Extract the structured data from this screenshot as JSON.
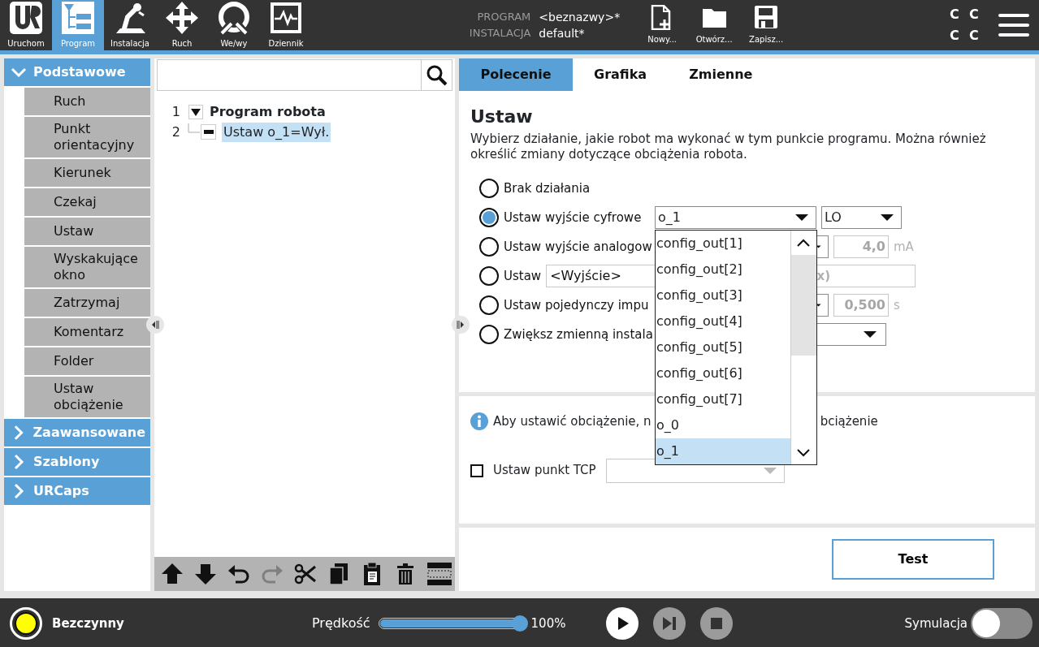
{
  "top_nav": [
    {
      "kind": "run",
      "label": "Uruchom",
      "selected": false
    },
    {
      "kind": "program",
      "label": "Program",
      "selected": true
    },
    {
      "kind": "installation",
      "label": "Instalacja",
      "selected": false
    },
    {
      "kind": "move",
      "label": "Ruch",
      "selected": false
    },
    {
      "kind": "io",
      "label": "We/wy",
      "selected": false
    },
    {
      "kind": "log",
      "label": "Dziennik",
      "selected": false
    }
  ],
  "file_info": [
    {
      "label": "PROGRAM",
      "value": "<beznazwy>*"
    },
    {
      "label": "INSTALACJA",
      "value": "default*"
    }
  ],
  "file_buttons": [
    {
      "kind": "new",
      "label": "Nowy..."
    },
    {
      "kind": "open",
      "label": "Otwórz..."
    },
    {
      "kind": "save",
      "label": "Zapisz..."
    }
  ],
  "indicators": [
    "C",
    "C",
    "C",
    "C"
  ],
  "sidebar": {
    "sections": [
      {
        "label": "Podstawowe",
        "expanded": true,
        "items": [
          "Ruch",
          "Punkt orientacyjny",
          "Kierunek",
          "Czekaj",
          "Ustaw",
          "Wyskakujące okno",
          "Zatrzymaj",
          "Komentarz",
          "Folder",
          "Ustaw obciążenie"
        ]
      },
      {
        "label": "Zaawansowane",
        "expanded": false
      },
      {
        "label": "Szablony",
        "expanded": false
      },
      {
        "label": "URCaps",
        "expanded": false
      }
    ]
  },
  "tree": {
    "nodes": [
      {
        "line": "1",
        "label": "Program robota",
        "expanded": true,
        "selected": false,
        "children": [
          {
            "line": "2",
            "label": "Ustaw o_1=Wył.",
            "selected": true
          }
        ]
      }
    ],
    "tools": [
      {
        "kind": "move-up",
        "disabled": false
      },
      {
        "kind": "move-down",
        "disabled": false
      },
      {
        "kind": "undo",
        "disabled": false
      },
      {
        "kind": "redo",
        "disabled": true
      },
      {
        "kind": "cut",
        "disabled": false
      },
      {
        "kind": "copy",
        "disabled": false
      },
      {
        "kind": "paste",
        "disabled": false
      },
      {
        "kind": "delete",
        "disabled": false
      },
      {
        "kind": "suppress",
        "disabled": false
      }
    ]
  },
  "tabs": [
    {
      "label": "Polecenie",
      "selected": true
    },
    {
      "label": "Grafika",
      "selected": false
    },
    {
      "label": "Zmienne",
      "selected": false
    }
  ],
  "command": {
    "title": "Ustaw",
    "description": "Wybierz działanie, jakie robot ma wykonać w tym punkcie programu. Można również określić zmiany dotyczące obciążenia robota.",
    "options": [
      {
        "kind": "none",
        "label": "Brak działania",
        "selected": false
      },
      {
        "kind": "digital",
        "label": "Ustaw wyjście cyfrowe",
        "selected": true,
        "output": "o_1",
        "value": "LO"
      },
      {
        "kind": "analog",
        "label": "Ustaw wyjście analogow",
        "selected": false,
        "value": "4,0",
        "unit": "mA"
      },
      {
        "kind": "expression",
        "label": "Ustaw",
        "selected": false,
        "value": "<Wyjście>",
        "tail": "x)"
      },
      {
        "kind": "pulse",
        "label": "Ustaw pojedynczy impu",
        "selected": false,
        "value": "0,500",
        "unit": "s"
      },
      {
        "kind": "increment",
        "label": "Zwiększ zmienną instala",
        "selected": false
      }
    ],
    "dropdown": {
      "items": [
        {
          "label": "config_out[1]",
          "selected": false
        },
        {
          "label": "config_out[2]",
          "selected": false
        },
        {
          "label": "config_out[3]",
          "selected": false
        },
        {
          "label": "config_out[4]",
          "selected": false
        },
        {
          "label": "config_out[5]",
          "selected": false
        },
        {
          "label": "config_out[6]",
          "selected": false
        },
        {
          "label": "config_out[7]",
          "selected": false
        },
        {
          "label": "o_0",
          "selected": false
        },
        {
          "label": "o_1",
          "selected": true
        }
      ]
    }
  },
  "payload": {
    "info_start": "Aby ustawić obciążenie, n",
    "info_end": "bciążenie",
    "tcp": {
      "label": "Ustaw punkt TCP",
      "checked": false
    }
  },
  "test_button": "Test",
  "footer": {
    "status": {
      "label": "Bezczynny",
      "color": "#ffff00"
    },
    "speed": {
      "label": "Prędkość",
      "level": 1.0,
      "reading": "100%"
    },
    "controls": [
      {
        "kind": "play",
        "disabled": false
      },
      {
        "kind": "step",
        "disabled": true
      },
      {
        "kind": "stop",
        "disabled": true
      }
    ],
    "simulation": {
      "label": "Symulacja",
      "on": false
    }
  }
}
